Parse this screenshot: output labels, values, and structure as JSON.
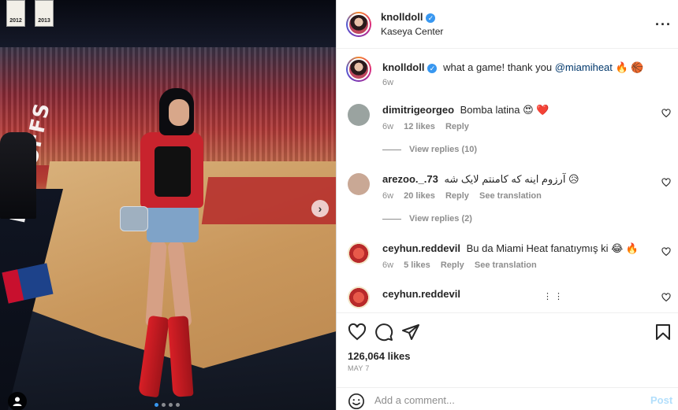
{
  "colors": {
    "accent": "#3897f0",
    "muted": "#8e8e8e",
    "text": "#262626",
    "link": "#00376b",
    "heart": "#ed4956"
  },
  "media": {
    "banners": [
      "2012",
      "2013"
    ],
    "sideline_text": "PLAYOFFS",
    "carousel": {
      "total": 4,
      "active": 1
    }
  },
  "header": {
    "username": "knolldoll",
    "verified": true,
    "location": "Kaseya Center",
    "more_icon": "more-horizontal-icon"
  },
  "caption": {
    "username": "knolldoll",
    "text_pre": "what a game! thank you",
    "mention": "@miamiheat",
    "emojis": "🔥 🏀",
    "time": "6w"
  },
  "comments": [
    {
      "username": "dimitrigeorgeo",
      "text": "Bomba latina 😍 ❤️",
      "time": "6w",
      "likes": "12 likes",
      "reply": "Reply",
      "view_replies": "View replies (10)"
    },
    {
      "username": "arezoo._.73",
      "text": "آرزوم اینه که کامنتم لایک شه 😥",
      "time": "6w",
      "likes": "20 likes",
      "reply": "Reply",
      "translate": "See translation",
      "view_replies": "View replies (2)"
    },
    {
      "username": "ceyhun.reddevil",
      "text": "Bu da Miami Heat fanatıymış ki 😂 🔥",
      "time": "6w",
      "likes": "5 likes",
      "reply": "Reply",
      "translate": "See translation"
    },
    {
      "username": "ceyhun.reddevil",
      "text": "⋮ ⋮"
    }
  ],
  "actions": {
    "like_icon": "heart-icon",
    "comment_icon": "comment-icon",
    "share_icon": "send-icon",
    "save_icon": "bookmark-icon"
  },
  "likes": "126,064 likes",
  "date": "MAY 7",
  "add_comment": {
    "placeholder": "Add a comment...",
    "post_label": "Post",
    "emoji_icon": "smiley-icon"
  }
}
